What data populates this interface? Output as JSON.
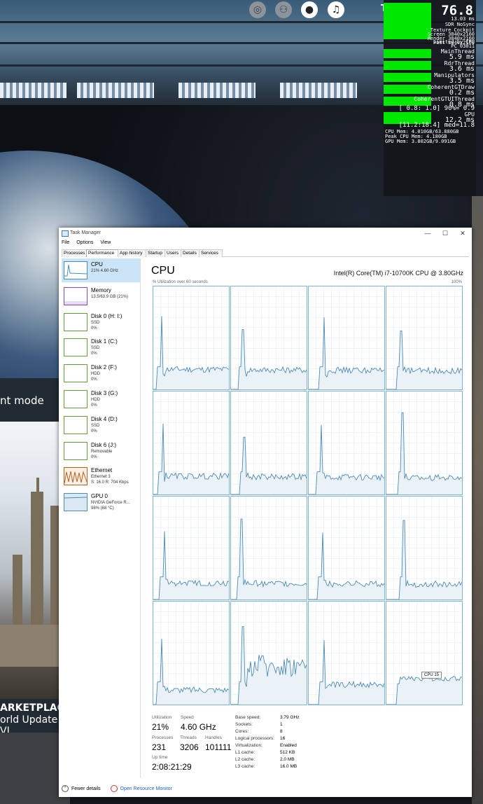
{
  "overlay": {
    "fps": "76.8",
    "frame_ms": "13.03 ms",
    "mode": "SDR NoSync",
    "lines": [
      "Texture Cockpit",
      "Screen 3840x2160",
      "Render 3840x2160",
      "Post 3840x2160"
    ],
    "limited": "Limited by CPU",
    "pc": "PC 03011",
    "threads": [
      {
        "name": "MainThread",
        "value": "5.9 ms"
      },
      {
        "name": "RdrThread",
        "value": "3.6 ms"
      },
      {
        "name": "Manipulators",
        "value": "3.5 ms"
      },
      {
        "name": "CoherentGTDraw",
        "value": "0.2 ms"
      },
      {
        "name": "CoherentGTUIThread",
        "value": "0.8 ms"
      }
    ],
    "range1": "[ 0.8: 1.0] 90%= 0.9",
    "gpu_label": "GPU",
    "gpu_value": "12.2 ms",
    "range2": "[11.2:18.4] med=11.8",
    "mem": [
      "CPU Mem: 4.010GB/63.880GB",
      "Peak CPU Mem: 4.180GB",
      "GPU Mem: 3.802GB/9.091GB"
    ]
  },
  "game": {
    "hud_letter": "T",
    "mode_text": "nt mode",
    "marketplace": "ARKETPLACE",
    "world_update": "orld Update VI"
  },
  "icons": [
    "swirl-icon",
    "friends-icon",
    "profile-icon",
    "notification-icon"
  ],
  "window": {
    "title": "Task Manager",
    "min": "—",
    "max": "☐",
    "close": "✕"
  },
  "menu": [
    "File",
    "Options",
    "View"
  ],
  "tabs": [
    "Processes",
    "Performance",
    "App history",
    "Startup",
    "Users",
    "Details",
    "Services"
  ],
  "sidebar": [
    {
      "name": "CPU",
      "sub": "21% 4.60 GHz",
      "sub2": ""
    },
    {
      "name": "Memory",
      "sub": "13.5/63.9 GB (21%)",
      "sub2": ""
    },
    {
      "name": "Disk 0 (H: I:)",
      "sub": "SSD",
      "sub2": "0%"
    },
    {
      "name": "Disk 1 (C:)",
      "sub": "SSD",
      "sub2": "0%"
    },
    {
      "name": "Disk 2 (F:)",
      "sub": "HDD",
      "sub2": "0%"
    },
    {
      "name": "Disk 3 (G:)",
      "sub": "HDD",
      "sub2": "0%"
    },
    {
      "name": "Disk 4 (D:)",
      "sub": "SSD",
      "sub2": "0%"
    },
    {
      "name": "Disk 6 (J:)",
      "sub": "Removable",
      "sub2": "0%"
    },
    {
      "name": "Ethernet",
      "sub": "Ethernet 3",
      "sub2": "S: 16.0 R: 704 Kbps"
    },
    {
      "name": "GPU 0",
      "sub": "NVIDIA GeForce R...",
      "sub2": "98% (68 °C)"
    }
  ],
  "main": {
    "title": "CPU",
    "model": "Intel(R) Core(TM) i7-10700K CPU @ 3.80GHz",
    "util_label": "% Utilization over 60 seconds",
    "util_max": "100%",
    "tooltip": "CPU 15"
  },
  "stats": {
    "utilization_label": "Utilization",
    "utilization": "21%",
    "speed_label": "Speed",
    "speed": "4.60 GHz",
    "processes_label": "Processes",
    "processes": "231",
    "threads_label": "Threads",
    "threads": "3206",
    "handles_label": "Handles",
    "handles": "101111",
    "uptime_label": "Up time",
    "uptime": "2:08:21:29"
  },
  "info": [
    {
      "label": "Base speed:",
      "value": "3.79 GHz"
    },
    {
      "label": "Sockets:",
      "value": "1"
    },
    {
      "label": "Cores:",
      "value": "8"
    },
    {
      "label": "Logical processors:",
      "value": "16"
    },
    {
      "label": "Virtualization:",
      "value": "Enabled"
    },
    {
      "label": "L1 cache:",
      "value": "512 KB"
    },
    {
      "label": "L2 cache:",
      "value": "2.0 MB"
    },
    {
      "label": "L3 cache:",
      "value": "16.0 MB"
    }
  ],
  "footer": {
    "fewer": "Fewer details",
    "monitor": "Open Resource Monitor"
  },
  "colors": {
    "cpu_line": "#4d8bb5",
    "cpu_fill": "#eaf2f8",
    "grid_line": "#dce8f2",
    "selected": "#cce4f7",
    "overlay_green": "#00e800"
  }
}
